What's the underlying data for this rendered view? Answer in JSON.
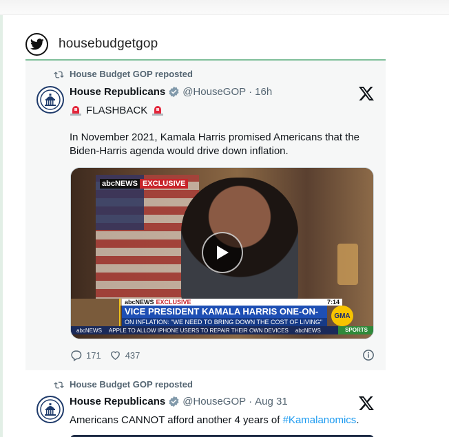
{
  "feed": {
    "handle": "housebudgetgop",
    "icon": "twitter-bird-icon"
  },
  "tweets": [
    {
      "reposted_by": "House Budget GOP reposted",
      "author_name": "House Republicans",
      "author_handle": "@HouseGOP",
      "separator": "·",
      "time": "16h",
      "flash_label": "FLASHBACK",
      "text": "In November 2021, Kamala Harris promised Americans that the Biden-Harris agenda would drive down inflation.",
      "video": {
        "badge_network": "abcNEWS",
        "badge_tag": "EXCLUSIVE",
        "strip_network": "abcNEWS",
        "strip_tag": "EXCLUSIVE",
        "strip_time": "7:14",
        "headline": "VICE PRESIDENT KAMALA HARRIS ONE-ON-ONE",
        "subhead": "ON INFLATION: \"WE NEED TO BRING DOWN THE COST OF LIVING\"",
        "logo": "GMA",
        "ticker_network": "abcNEWS",
        "ticker_text": "APPLE TO ALLOW IPHONE USERS TO REPAIR THEIR OWN DEVICES",
        "ticker_network2": "abcNEWS",
        "ticker_section": "SPORTS"
      },
      "replies": "171",
      "likes": "437"
    },
    {
      "reposted_by": "House Budget GOP reposted",
      "author_name": "House Republicans",
      "author_handle": "@HouseGOP",
      "separator": "·",
      "time": "Aug 31",
      "text_before": "Americans CANNOT afford another 4 years of ",
      "hashtag": "#Kamalanomics",
      "text_after": "."
    }
  ],
  "colors": {
    "accent_rule": "#7fbf9a",
    "verified": "#829aab",
    "hashtag": "#1d9bf0",
    "muted_text": "#536471"
  }
}
